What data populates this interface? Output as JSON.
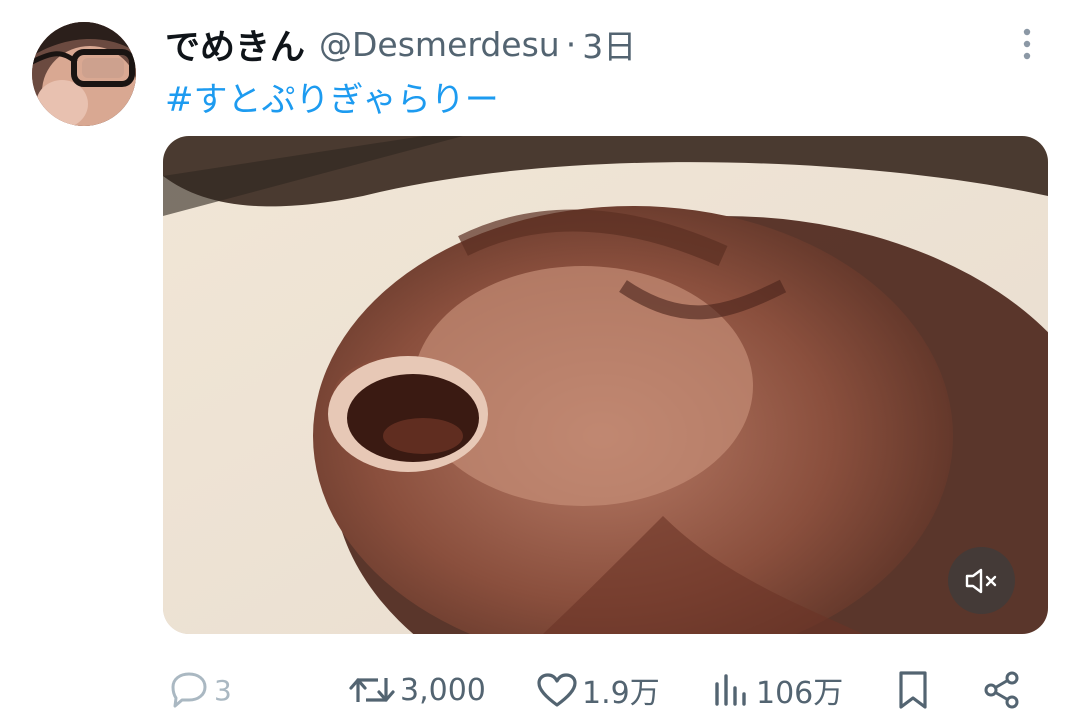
{
  "tweet": {
    "display_name": "でめきん",
    "handle": "@Desmerdesu",
    "separator": "·",
    "time": "3日",
    "hashtag": "#すとぷりぎゃらりー"
  },
  "actions": {
    "reply_count": "3",
    "retweet_count": "3,000",
    "like_count": "1.9万",
    "view_count": "106万"
  },
  "icons": {
    "more": "more-vertical-icon",
    "mute": "volume-muted-icon",
    "reply": "comment-icon",
    "retweet": "retweet-icon",
    "like": "heart-icon",
    "views": "bar-chart-icon",
    "bookmark": "bookmark-icon",
    "share": "share-icon"
  },
  "colors": {
    "link": "#1d9bf0",
    "secondary_text": "#536471",
    "muted_count": "#aab8c2"
  }
}
